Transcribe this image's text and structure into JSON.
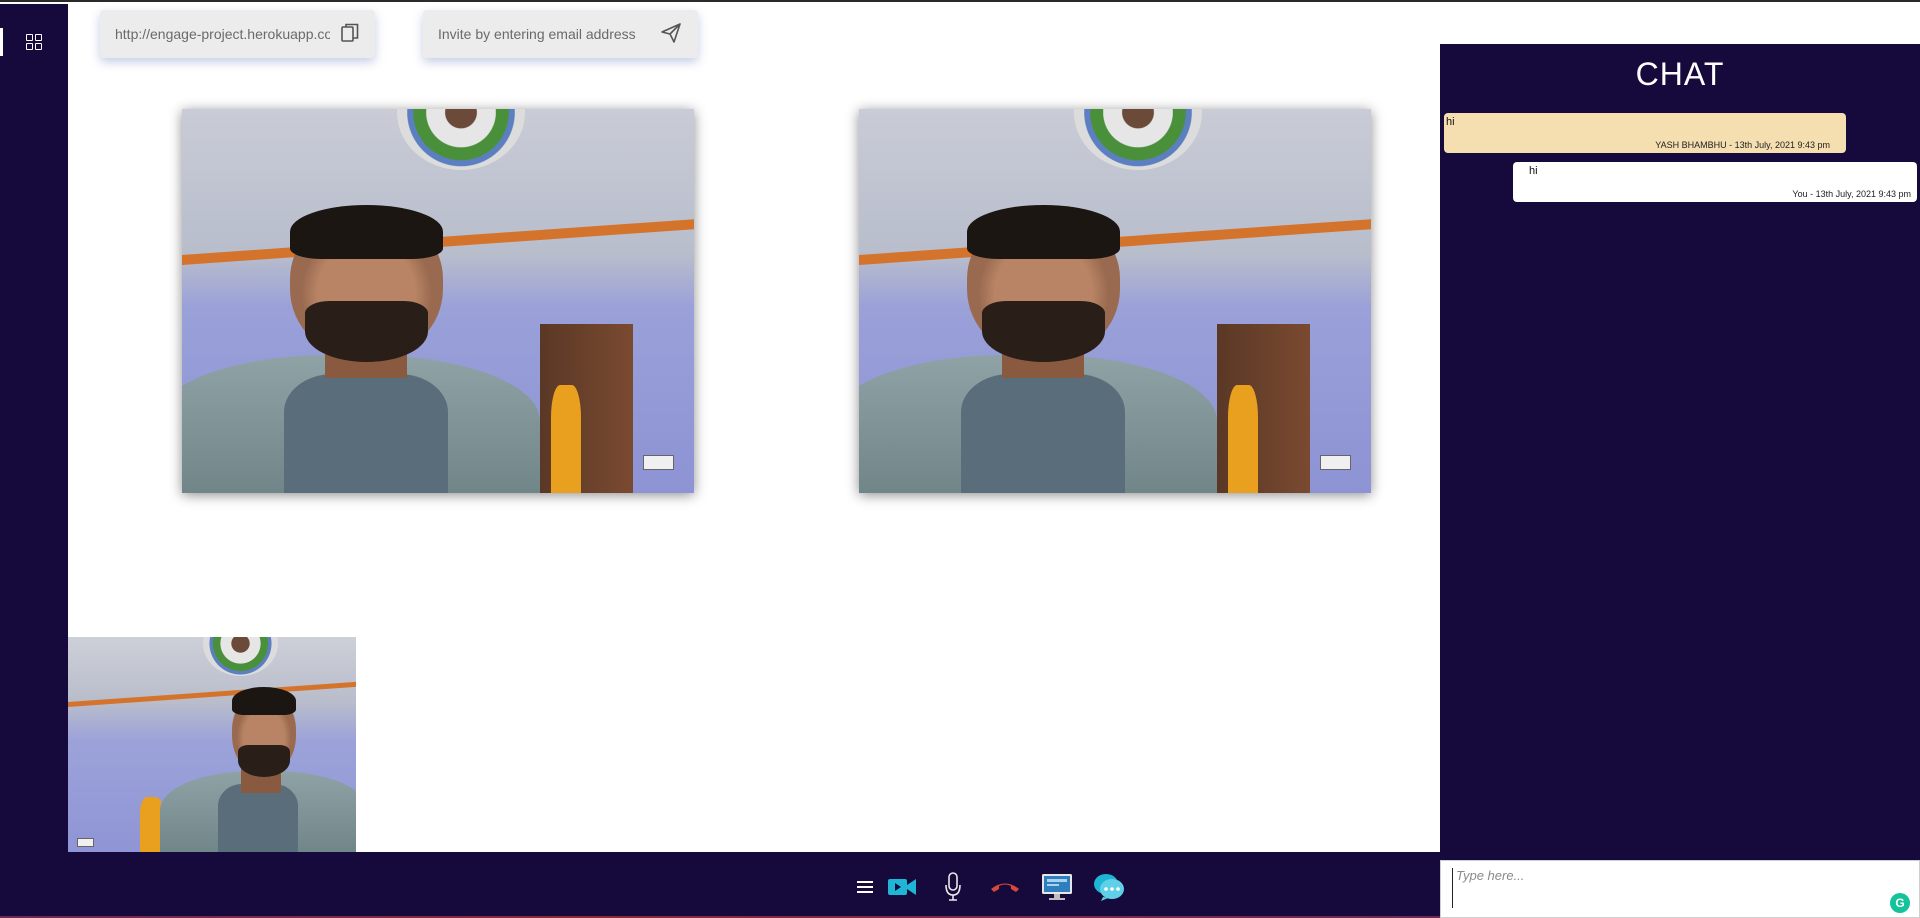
{
  "invite": {
    "meeting_link": "http://engage-project.herokuapp.com",
    "email_placeholder": "Invite by entering email address"
  },
  "icons": {
    "grid": "grid-view-icon",
    "leave": "exit-icon",
    "copy": "copy-icon",
    "send": "send-icon",
    "menu": "hamburger-menu-icon",
    "video": "video-camera-icon",
    "mic": "microphone-icon",
    "end_call": "phone-hangup-icon",
    "screen_share": "screen-share-icon",
    "chat": "chat-bubble-icon"
  },
  "chat": {
    "title": "CHAT",
    "messages": [
      {
        "text": "hi",
        "meta": "YASH BHAMBHU - 13th July, 2021 9:43 pm",
        "direction": "incoming"
      },
      {
        "text": "hi",
        "meta": "You - 13th July, 2021 9:43 pm",
        "direction": "outgoing"
      }
    ],
    "input_placeholder": "Type here...",
    "input_value": ""
  },
  "colors": {
    "panel_bg": "#150a3b",
    "incoming_bubble": "#f5deb0",
    "outgoing_bubble": "#ffffff",
    "accent_cyan": "#1fb6d6",
    "end_call_red": "#d9463a",
    "grammarly_green": "#15c39a"
  }
}
